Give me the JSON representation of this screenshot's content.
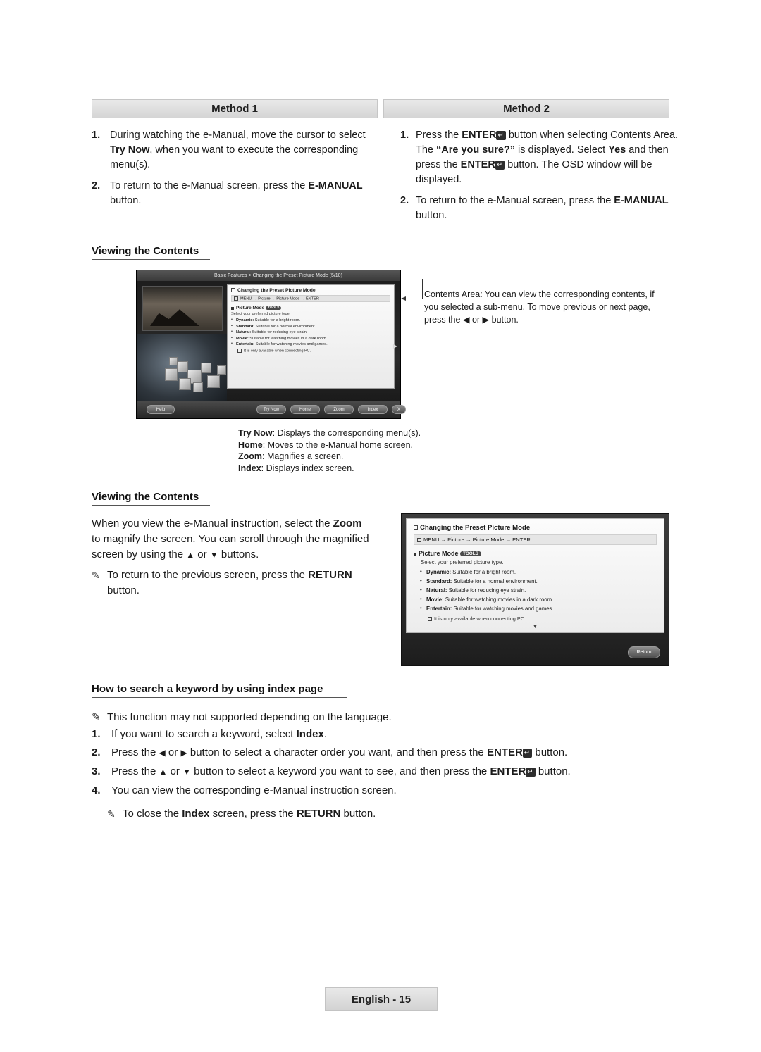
{
  "methods": {
    "method1_label": "Method 1",
    "method2_label": "Method 2",
    "method1_steps": [
      {
        "num": "1.",
        "text": "During watching the e-Manual, move the cursor to select Try Now, when you want to execute the corresponding menu(s)."
      },
      {
        "num": "2.",
        "text": "To return to the e-Manual screen, press the E-MANUAL button."
      }
    ],
    "method2_steps": [
      {
        "num": "1.",
        "text": "Press the ENTER button when selecting Contents Area. The “Are you sure?” is displayed. Select Yes and then press the ENTER button. The OSD window will be displayed."
      },
      {
        "num": "2.",
        "text": "To return to the e-Manual screen, press the E-MANUAL button."
      }
    ]
  },
  "headings": {
    "viewing_contents_1": "Viewing the Contents",
    "viewing_contents_2": "Viewing the Contents",
    "index_page": "How to search a keyword by using index page"
  },
  "emanual_screenshot": {
    "title_bar": "Basic Features > Changing the Preset Picture Mode (5/10)",
    "panel_title": "Changing the Preset Picture Mode",
    "panel_path": "MENU → Picture → Picture Mode → ENTER",
    "panel_mode": "Picture Mode",
    "panel_tools": "TOOLS",
    "panel_sub": "Select your preferred picture type.",
    "panel_items": [
      {
        "term": "Dynamic:",
        "desc": " Suitable for a bright room."
      },
      {
        "term": "Standard:",
        "desc": " Suitable for a normal environment."
      },
      {
        "term": "Natural:",
        "desc": " Suitable for reducing eye strain."
      },
      {
        "term": "Movie:",
        "desc": " Suitable for watching movies in a dark room."
      },
      {
        "term": "Entertain:",
        "desc": " Suitable for watching movies and games."
      }
    ],
    "panel_note": "It is only available when connecting PC.",
    "buttons": {
      "help": "Help",
      "try_now": "Try Now",
      "home": "Home",
      "zoom": "Zoom",
      "index": "Index",
      "close": "X"
    }
  },
  "callout": "Contents Area: You can view the corresponding contents, if you selected a sub-menu. To move previous or next page, press the ◀ or ▶ button.",
  "legend": [
    {
      "term": "Try Now",
      "desc": ": Displays the corresponding menu(s)."
    },
    {
      "term": "Home",
      "desc": ": Moves to the e-Manual home screen."
    },
    {
      "term": "Zoom",
      "desc": ": Magnifies a screen."
    },
    {
      "term": "Index",
      "desc": ": Displays index screen."
    }
  ],
  "viewing2": {
    "paragraph": "When you view the e-Manual instruction, select the Zoom to magnify the screen. You can scroll through the magnified screen by using the ▲ or ▼ buttons.",
    "note": "To return to the previous screen, press the RETURN button."
  },
  "osd_screenshot": {
    "title": "Changing the Preset Picture Mode",
    "path": "MENU → Picture → Picture Mode → ENTER",
    "mode": "Picture Mode",
    "tools": "TOOLS",
    "sub": "Select your preferred picture type.",
    "items": [
      {
        "term": "Dynamic:",
        "desc": " Suitable for a bright room."
      },
      {
        "term": "Standard:",
        "desc": " Suitable for a normal environment."
      },
      {
        "term": "Natural:",
        "desc": " Suitable for reducing eye strain."
      },
      {
        "term": "Movie:",
        "desc": " Suitable for watching movies in a dark room."
      },
      {
        "term": "Entertain:",
        "desc": " Suitable for watching movies and games."
      }
    ],
    "note": "It is only available when connecting PC.",
    "return_button": "Return"
  },
  "index_section": {
    "note": "This function may not supported depending on the language.",
    "steps": [
      {
        "num": "1.",
        "text": "If you want to search a keyword, select Index."
      },
      {
        "num": "2.",
        "text": "Press the ◀ or ▶ button to select a character order you want, and then press the ENTER button."
      },
      {
        "num": "3.",
        "text": "Press the ▲ or ▼ button to select a keyword you want to see, and then press the ENTER button."
      },
      {
        "num": "4.",
        "text": "You can view the corresponding e-Manual instruction screen."
      }
    ],
    "close_note": "To close the Index screen, press the RETURN button."
  },
  "footer": {
    "page_label": "English - 15"
  }
}
